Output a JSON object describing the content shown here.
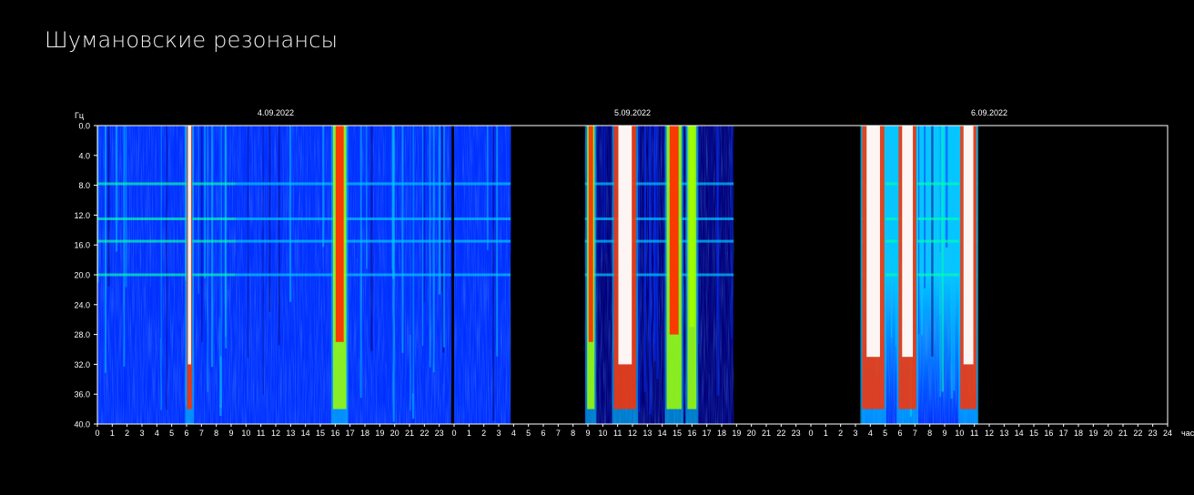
{
  "page": {
    "title": "Шумановские резонансы"
  },
  "chart_data": {
    "type": "heatmap",
    "title": "Шумановские резонансы",
    "ylabel": "Гц",
    "xlabel": "час",
    "ylim": [
      0,
      40
    ],
    "y_ticks": [
      "0.0",
      "4.0",
      "8.0",
      "12.0",
      "16.0",
      "20.0",
      "24.0",
      "28.0",
      "32.0",
      "36.0",
      "40.0"
    ],
    "hours_range": [
      0,
      72
    ],
    "date_labels": [
      {
        "label": "4.09.2022",
        "hour": 12
      },
      {
        "label": "5.09.2022",
        "hour": 36
      },
      {
        "label": "6.09.2022",
        "hour": 60
      }
    ],
    "x_tick_labels": [
      "0",
      "1",
      "2",
      "3",
      "4",
      "5",
      "6",
      "7",
      "8",
      "9",
      "10",
      "11",
      "12",
      "13",
      "14",
      "15",
      "16",
      "17",
      "18",
      "19",
      "20",
      "21",
      "22",
      "23",
      "0",
      "1",
      "2",
      "3",
      "4",
      "5",
      "6",
      "7",
      "8",
      "9",
      "10",
      "11",
      "12",
      "13",
      "14",
      "15",
      "16",
      "17",
      "18",
      "19",
      "20",
      "21",
      "22",
      "23",
      "0",
      "1",
      "2",
      "3",
      "4",
      "5",
      "6",
      "7",
      "8",
      "9",
      "10",
      "11",
      "12",
      "13",
      "14",
      "15",
      "16",
      "17",
      "18",
      "19",
      "20",
      "21",
      "22",
      "23",
      "24"
    ],
    "data_end_hour": 59.2,
    "resonance_bands_hz": [
      7.8,
      12.5,
      15.5,
      20
    ],
    "segments": [
      {
        "from": 0,
        "to": 9.3,
        "intensity": 0.55
      },
      {
        "from": 9.3,
        "to": 23.8,
        "intensity": 0.4
      },
      {
        "from": 24,
        "to": 27.8,
        "intensity": 0.35
      },
      {
        "from": 32.8,
        "to": 42.8,
        "intensity": 0.08
      },
      {
        "from": 51.4,
        "to": 59.2,
        "intensity": 0.75
      }
    ],
    "bursts": [
      {
        "hour": 6.2,
        "width": 0.35,
        "level": 1.0
      },
      {
        "hour": 16.3,
        "width": 0.9,
        "level": 0.85
      },
      {
        "hour": 33.2,
        "width": 0.5,
        "level": 0.85
      },
      {
        "hour": 35.5,
        "width": 1.5,
        "level": 1.0
      },
      {
        "hour": 38.8,
        "width": 1.0,
        "level": 0.8
      },
      {
        "hour": 40.0,
        "width": 0.6,
        "level": 0.75
      },
      {
        "hour": 52.2,
        "width": 1.5,
        "level": 0.95
      },
      {
        "hour": 54.5,
        "width": 1.2,
        "level": 0.95
      },
      {
        "hour": 58.6,
        "width": 1.1,
        "level": 1.0
      }
    ],
    "colormap": [
      "#000010",
      "#00007a",
      "#0030ff",
      "#00c8ff",
      "#00ffb0",
      "#a0ff00",
      "#ff3000",
      "#ffffff"
    ],
    "grid": false,
    "legend": "none"
  }
}
